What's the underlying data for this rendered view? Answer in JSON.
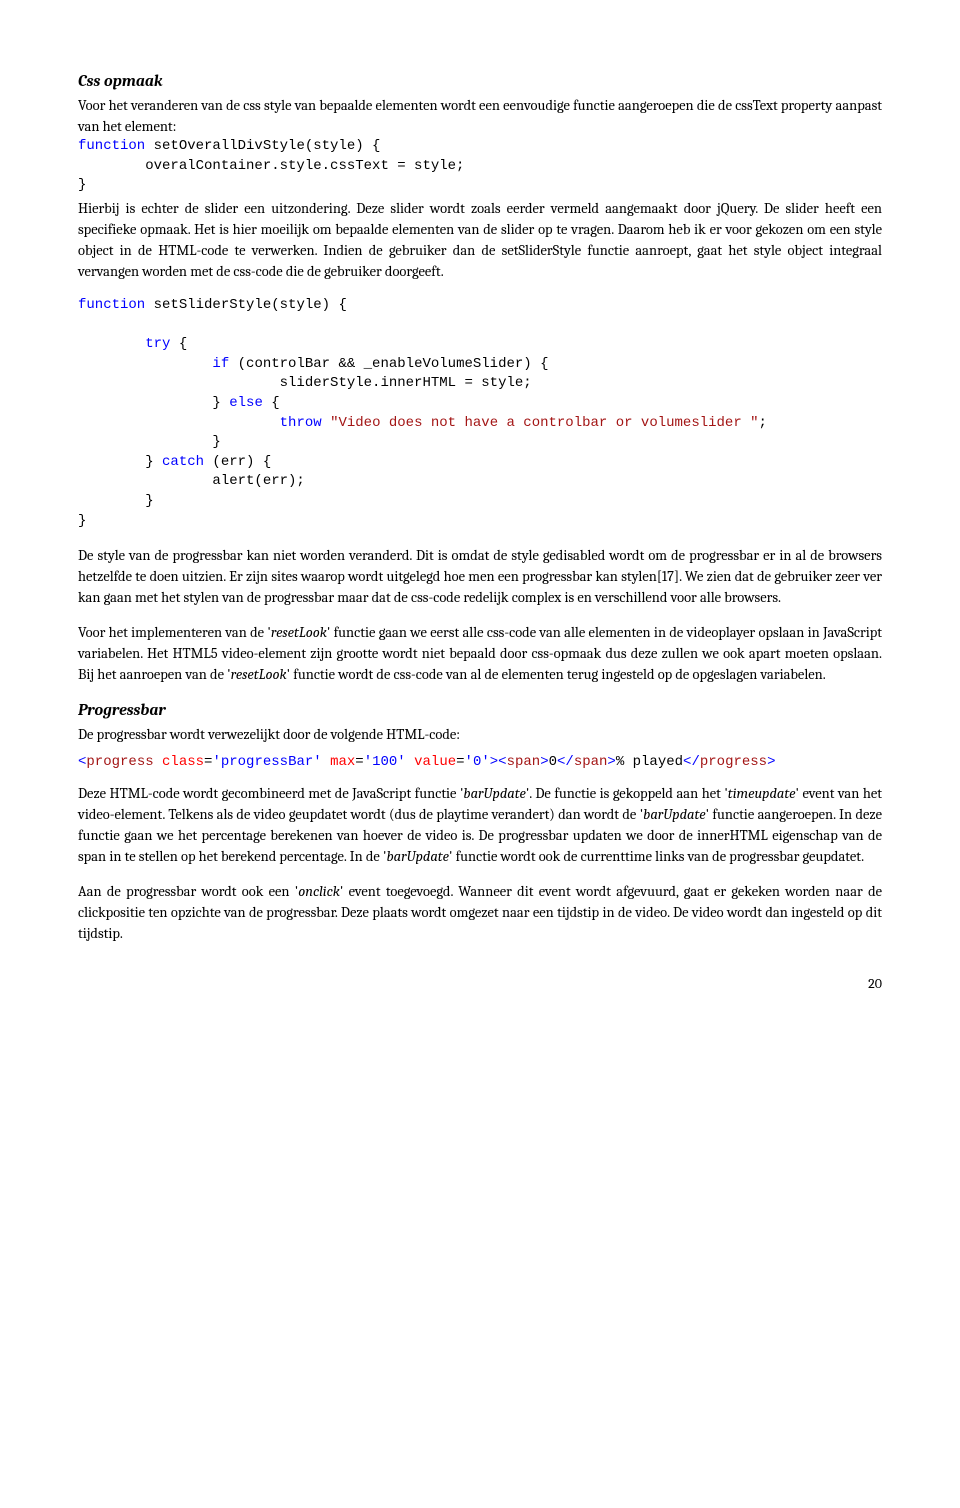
{
  "sections": {
    "css_opmaak": {
      "heading": "Css opmaak",
      "para1": "Voor het veranderen van de css style van bepaalde elementen wordt een eenvoudige functie aangeroepen die de cssText property aanpast van het element:",
      "para2": "Hierbij is echter de slider een uitzondering. Deze slider wordt zoals eerder vermeld aangemaakt door jQuery. De slider heeft een specifieke opmaak. Het is hier moeilijk om bepaalde elementen van de slider op te vragen. Daarom heb ik er voor gekozen om een style object in de HTML-code te verwerken. Indien de gebruiker dan de setSliderStyle functie aanroept, gaat het style object integraal vervangen worden met de css-code die de gebruiker doorgeeft.",
      "para3": "De style van de progressbar kan niet worden veranderd. Dit is omdat de style gedisabled wordt om de progressbar er in al de browsers hetzelfde te doen uitzien. Er zijn sites waarop wordt uitgelegd hoe men een progressbar kan stylen[17]. We zien dat de gebruiker zeer ver kan gaan met het stylen van de progressbar maar dat de css-code redelijk complex is en verschillend voor alle browsers.",
      "para4_pre": "Voor het implementeren van de '",
      "para4_i1": "resetLook",
      "para4_mid1": "' functie gaan we eerst alle css-code van alle elementen in de videoplayer opslaan in JavaScript variabelen. Het HTML5 video-element zijn grootte wordt niet bepaald door css-opmaak dus deze zullen we ook apart moeten opslaan. Bij het aanroepen van de '",
      "para4_i2": "resetLook",
      "para4_post": "' functie wordt de css-code van al de elementen terug ingesteld op de opgeslagen variabelen."
    },
    "progressbar": {
      "heading": "Progressbar",
      "para1": "De progressbar wordt verwezelijkt door de volgende HTML-code:",
      "para2_pre": "Deze HTML-code wordt gecombineerd met de JavaScript functie '",
      "para2_i1": "barUpdate",
      "para2_mid1": "'. De functie is gekoppeld aan het '",
      "para2_i2": "timeupdate",
      "para2_mid2": "' event van het video-element. Telkens als de video geupdatet wordt (dus de playtime verandert) dan wordt de '",
      "para2_i3": "barUpdate",
      "para2_mid3": "' functie aangeroepen. In deze functie gaan we het percentage berekenen van hoever de video is. De progressbar updaten we door de innerHTML eigenschap van de span in te stellen op het berekend percentage. In de '",
      "para2_i4": "barUpdate",
      "para2_post": "' functie wordt ook de currenttime links van de progressbar geupdatet.",
      "para3_pre": "Aan de progressbar wordt ook een '",
      "para3_i1": "onclick",
      "para3_post": "' event toegevoegd. Wanneer dit event wordt afgevuurd, gaat er gekeken worden naar de clickpositie ten opzichte van de progressbar. Deze plaats wordt omgezet naar een tijdstip in de video. De video wordt dan ingesteld op dit tijdstip."
    }
  },
  "code": {
    "c1": {
      "kw_function": "function",
      "fn1_rest": " setOverallDivStyle(style) {",
      "l2": "        overalContainer.style.cssText = style;",
      "l3": "}"
    },
    "c2": {
      "kw_function": "function",
      "fn_rest": " setSliderStyle(style) {",
      "kw_try": "try",
      "try_rest": " {",
      "kw_if": "if",
      "if_rest": " (controlBar && _enableVolumeSlider) {",
      "inner1": "                        sliderStyle.innerHTML = style;",
      "else_pre": "                } ",
      "kw_else": "else",
      "else_rest": " {",
      "kw_throw": "throw",
      "throw_sp": " ",
      "throw_str": "\"Video does not have a controlbar or volumeslider \"",
      "throw_end": ";",
      "close1": "                }",
      "catch_pre": "        } ",
      "kw_catch": "catch",
      "catch_rest": " (err) {",
      "alert": "                alert(err);",
      "close2": "        }",
      "close3": "}"
    },
    "c3": {
      "lt1": "<",
      "tag_progress_open": "progress",
      "sp": " ",
      "attr_class": "class",
      "eq": "=",
      "val_class": "'progressBar'",
      "attr_max": "max",
      "val_max": "'100'",
      "attr_value": "value",
      "val_value": "'0'",
      "gt": ">",
      "lt2": "<",
      "tag_span": "span",
      "gt2": ">",
      "span_text": "0",
      "lt3": "</",
      "tag_span_close": "span",
      "gt3": ">",
      "text_after": "% played",
      "lt4": "</",
      "tag_progress_close": "progress",
      "gt4": ">"
    }
  },
  "pagenum": "20"
}
